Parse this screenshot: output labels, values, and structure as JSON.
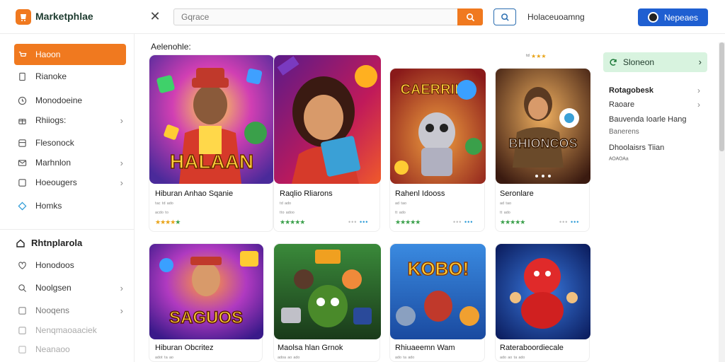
{
  "app": {
    "title": "Marketphlae"
  },
  "search": {
    "placeholder": "Gqrace"
  },
  "header": {
    "link": "Holaceuoamng",
    "signin": "Nepeaes"
  },
  "sidebar": {
    "items": [
      {
        "label": "Haoon",
        "icon": "cart-icon"
      },
      {
        "label": "Rianoke",
        "icon": "file-icon"
      },
      {
        "label": "Monodoeine",
        "icon": "clock-icon"
      },
      {
        "label": "Rhiiogs:",
        "icon": "gift-icon"
      },
      {
        "label": "Flesonock",
        "icon": "grid-icon"
      },
      {
        "label": "Marhnlon",
        "icon": "mail-icon"
      },
      {
        "label": "Hoeougers",
        "icon": "box-icon"
      },
      {
        "label": "Homks",
        "icon": "tag-icon"
      }
    ],
    "heading": "Rhtnplarola",
    "sub_items": [
      {
        "label": "Honodoos",
        "icon": "heart-icon"
      },
      {
        "label": "Noolgsen",
        "icon": "search-icon"
      },
      {
        "label": "Nooqens",
        "icon": "box-icon"
      },
      {
        "label": "Nenqmaoaaciek",
        "icon": "box-icon"
      },
      {
        "label": "Neanaoo",
        "icon": "box-icon"
      }
    ]
  },
  "main": {
    "section_label": "Aelenohle:",
    "rating_meta": "ᵗᵈ",
    "cards": [
      {
        "title": "Hiburan Anhao Sqanie",
        "meta1": "ᵗᵃᶜ ᵗᵈ ᵃᵈᵒ",
        "meta2": "ᵃᶜᵈᵒ ᵗᵒ",
        "art_text": "HALAAN"
      },
      {
        "title": "Raqlio Rliarons",
        "meta1": "ᵗᵈ ᵃᵈᵒ",
        "meta2": "ᵗᵗᵒ ᵃᵈᵒᵒ",
        "art_text": ""
      },
      {
        "title": "Rahenl Idooss",
        "meta1": "ᵃᵈ ᵗᵃᵒ",
        "meta2": "ᵗᵗ ᵃᵈᵒ",
        "art_text": "CAERRIK"
      },
      {
        "title": "Seronlare",
        "meta1": "ᵃᵈ ᵗᵃᵒ",
        "meta2": "ᵗᵗ ᵃᵈᵒ",
        "art_text": "BHIONCOS"
      },
      {
        "title": "Hiburan Obcritez",
        "meta1": "ᵃᵈᵒᵗ ᵗᵃ ᵃᵒ",
        "meta2": "",
        "art_text": "SAGUOS"
      },
      {
        "title": "Maolsa hlan Grnok",
        "meta1": "ᵃᵈᵒᵃ ᵃᵒ ᵃᵈᵒ",
        "meta2": "",
        "art_text": ""
      },
      {
        "title": "Rhiuaeemn Wam",
        "meta1": "ᵃᵈᵒ ᵗᵃ ᵃᵈᵒ",
        "meta2": "",
        "art_text": "KOBO!"
      },
      {
        "title": "Rateraboordiecale",
        "meta1": "ᵃᵈᵒ ᵃᵒ ᵗᵃ ᵃᵈᵒ",
        "meta2": "",
        "art_text": ""
      }
    ]
  },
  "right_panel": {
    "promo": "Sloneon",
    "items": [
      {
        "label": "Rotagobesk",
        "style": "bold"
      },
      {
        "label": "Raoare",
        "style": "normal"
      },
      {
        "label": "Bauvenda Ioarle Hang",
        "style": "normal"
      },
      {
        "label": "Banerens",
        "style": "sub"
      },
      {
        "label": "Dhoolaisrs Tiian",
        "style": "normal"
      },
      {
        "label": "ᴬᴼᴬᴼᴬᵃ",
        "style": "sub"
      }
    ]
  },
  "colors": {
    "accent": "#f0791f",
    "primary": "#1f5fd1",
    "promo_bg": "#d8f3df"
  }
}
